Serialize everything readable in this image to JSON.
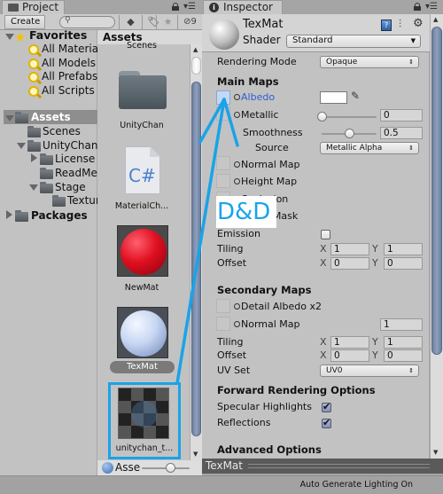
{
  "project": {
    "tab_label": "Project",
    "create_label": "Create",
    "search_placeholder": "",
    "hidden_count": "9",
    "favorites": {
      "label": "Favorites",
      "items": [
        "All Materials",
        "All Models",
        "All Prefabs",
        "All Scripts"
      ]
    },
    "tree": {
      "assets": "Assets",
      "scenes": "Scenes",
      "unitychan": "UnityChan",
      "license": "License",
      "readme": "ReadMe",
      "stage": "Stage",
      "textures": "Textur",
      "packages": "Packages"
    },
    "grid": {
      "header": "Assets",
      "items": [
        {
          "label": "Scenes",
          "type": "folder"
        },
        {
          "label": "UnityChan",
          "type": "folder"
        },
        {
          "label": "MaterialCh...",
          "type": "script"
        },
        {
          "label": "NewMat",
          "type": "material-red"
        },
        {
          "label": "TexMat",
          "type": "material-white",
          "selected": true
        },
        {
          "label": "unitychan_t...",
          "type": "texture",
          "highlighted": true
        }
      ],
      "script_glyph": "C#",
      "footer_label": "Asse",
      "zoom_slider_value": 0.6
    }
  },
  "inspector": {
    "tab_label": "Inspector",
    "material_name": "TexMat",
    "shader_label": "Shader",
    "shader_value": "Standard",
    "rendering_mode_label": "Rendering Mode",
    "rendering_mode_value": "Opaque",
    "main_maps": {
      "title": "Main Maps",
      "albedo": "Albedo",
      "metallic": "Metallic",
      "metallic_value": "0",
      "metallic_slider": 0,
      "smoothness": "Smoothness",
      "smoothness_value": "0.5",
      "smoothness_slider": 0.5,
      "source": "Source",
      "source_value": "Metallic Alpha",
      "normal_map": "Normal Map",
      "height_map": "Height Map",
      "occlusion": "Occlusion",
      "detail_mask": "Detail Mask",
      "emission": "Emission",
      "emission_checked": false,
      "tiling": "Tiling",
      "tiling_x": "1",
      "tiling_y": "1",
      "offset": "Offset",
      "offset_x": "0",
      "offset_y": "0"
    },
    "secondary_maps": {
      "title": "Secondary Maps",
      "detail_albedo": "Detail Albedo x2",
      "normal_map": "Normal Map",
      "normal_value": "1",
      "tiling": "Tiling",
      "tiling_x": "1",
      "tiling_y": "1",
      "offset": "Offset",
      "offset_x": "0",
      "offset_y": "0",
      "uv_set": "UV Set",
      "uv_set_value": "UV0"
    },
    "forward": {
      "title": "Forward Rendering Options",
      "specular": "Specular Highlights",
      "specular_checked": true,
      "reflections": "Reflections",
      "reflections_checked": true
    },
    "advanced_title": "Advanced Options",
    "preview_label": "TexMat",
    "x_label": "X",
    "y_label": "Y"
  },
  "annotation": {
    "dd_label": "D&D",
    "color": "#1aa3e8"
  },
  "status_bar": {
    "text": "Auto Generate Lighting On"
  }
}
